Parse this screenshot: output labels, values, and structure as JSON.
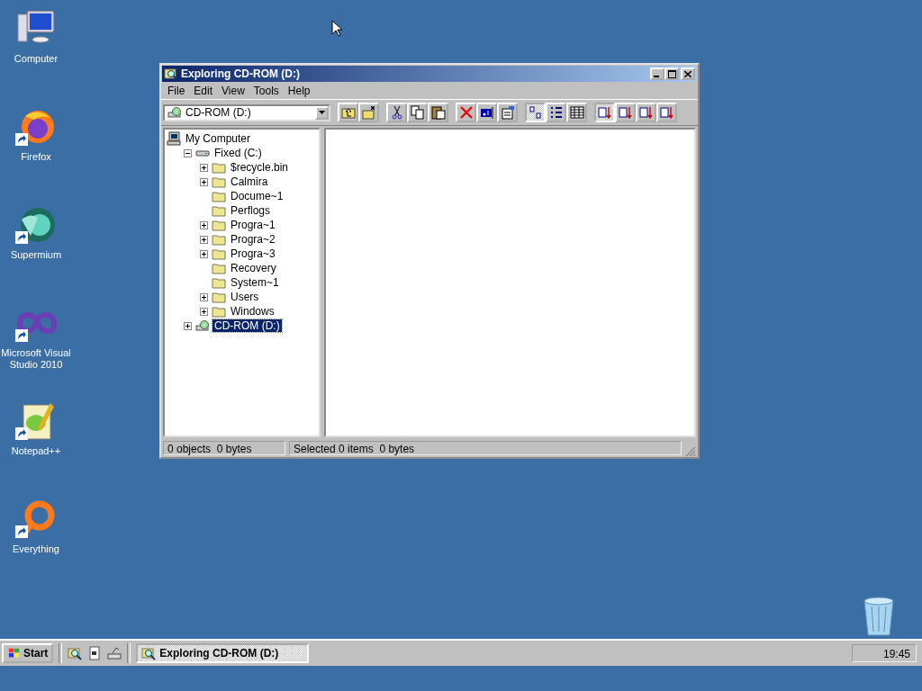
{
  "desktop_icons": [
    {
      "label": "Computer",
      "kind": "computer",
      "shortcut": false
    },
    {
      "label": "Firefox",
      "kind": "firefox",
      "shortcut": true
    },
    {
      "label": "Supermium",
      "kind": "supermium",
      "shortcut": true
    },
    {
      "label": "Microsoft Visual Studio 2010",
      "kind": "visualstudio",
      "shortcut": true
    },
    {
      "label": "Notepad++",
      "kind": "notepad",
      "shortcut": true
    },
    {
      "label": "Everything",
      "kind": "everything",
      "shortcut": true
    }
  ],
  "window": {
    "title": "Exploring CD-ROM (D:)",
    "menu": [
      "File",
      "Edit",
      "View",
      "Tools",
      "Help"
    ],
    "drive_select": {
      "value": "CD-ROM (D:)"
    },
    "toolbar": [
      [
        {
          "kind": "up",
          "pressed": false
        },
        {
          "kind": "newfolder",
          "pressed": false
        }
      ],
      [
        {
          "kind": "cut",
          "pressed": false
        },
        {
          "kind": "copy",
          "pressed": false
        },
        {
          "kind": "paste",
          "pressed": false
        }
      ],
      [
        {
          "kind": "delete",
          "pressed": false
        },
        {
          "kind": "rename",
          "pressed": false
        },
        {
          "kind": "properties",
          "pressed": false
        }
      ],
      [
        {
          "kind": "largeicons",
          "pressed": true
        },
        {
          "kind": "smallicons",
          "pressed": false
        },
        {
          "kind": "details",
          "pressed": false
        }
      ],
      [
        {
          "kind": "sortname",
          "pressed": true
        },
        {
          "kind": "sorttype",
          "pressed": false
        },
        {
          "kind": "sortsize",
          "pressed": false
        },
        {
          "kind": "sortdate",
          "pressed": false
        }
      ]
    ],
    "tree": [
      {
        "label": "My Computer",
        "kind": "computer",
        "selected": false,
        "children": [
          {
            "label": "Fixed (C:)",
            "kind": "harddisk",
            "selected": false,
            "expandable": true,
            "expanded": true,
            "children": [
              {
                "label": "$recycle.bin",
                "kind": "folder",
                "selected": false,
                "expandable": true,
                "expanded": false
              },
              {
                "label": "Calmira",
                "kind": "folder",
                "selected": false,
                "expandable": true,
                "expanded": false
              },
              {
                "label": "Docume~1",
                "kind": "folder",
                "selected": false,
                "expandable": false
              },
              {
                "label": "Perflogs",
                "kind": "folder",
                "selected": false,
                "expandable": false
              },
              {
                "label": "Progra~1",
                "kind": "folder",
                "selected": false,
                "expandable": true,
                "expanded": false
              },
              {
                "label": "Progra~2",
                "kind": "folder",
                "selected": false,
                "expandable": true,
                "expanded": false
              },
              {
                "label": "Progra~3",
                "kind": "folder",
                "selected": false,
                "expandable": true,
                "expanded": false
              },
              {
                "label": "Recovery",
                "kind": "folder",
                "selected": false,
                "expandable": false
              },
              {
                "label": "System~1",
                "kind": "folder",
                "selected": false,
                "expandable": false
              },
              {
                "label": "Users",
                "kind": "folder",
                "selected": false,
                "expandable": true,
                "expanded": false
              },
              {
                "label": "Windows",
                "kind": "folder",
                "selected": false,
                "expandable": true,
                "expanded": false
              }
            ]
          },
          {
            "label": "CD-ROM (D:)",
            "kind": "cdrom",
            "selected": true,
            "expandable": true,
            "expanded": false
          }
        ]
      }
    ],
    "status_bar": [
      "0 objects  0 bytes",
      "Selected 0 items  0 bytes"
    ]
  },
  "taskbar": {
    "start": "Start",
    "quick_launch": [
      {
        "kind": "explorer"
      },
      {
        "kind": "document"
      },
      {
        "kind": "drive"
      }
    ],
    "tasks": [
      {
        "label": "Exploring CD-ROM (D:)",
        "active": true
      }
    ],
    "clock": "19:45"
  }
}
